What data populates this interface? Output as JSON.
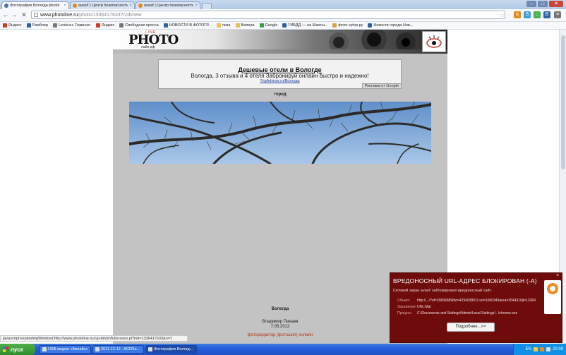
{
  "browser": {
    "tabs": [
      {
        "label": "Фотография Вологда photol",
        "active": true
      },
      {
        "label": "avast! | Центр безопасности",
        "active": false
      },
      {
        "label": "avast! | Центр безопасности",
        "active": false
      }
    ],
    "url_host": "www.photoline.ru",
    "url_path": "/photo/1336417633?rzdvnew",
    "window_buttons": {
      "min": "–",
      "max": "□",
      "close": "✕"
    }
  },
  "bookmarks": [
    {
      "label": "Яндекс",
      "icon": "yandex-icon"
    },
    {
      "label": "Рамблер",
      "icon": "rambler-icon"
    },
    {
      "label": "Lenta.ru: Главное:",
      "icon": "lenta-icon"
    },
    {
      "label": "Яндекс",
      "icon": "yandex-icon"
    },
    {
      "label": "Свободная пресса",
      "icon": "press-icon"
    },
    {
      "label": "НОВОСТИ В ФОТОГР...",
      "icon": "news-icon"
    },
    {
      "label": "лиза",
      "icon": "folder-icon"
    },
    {
      "label": "Валера",
      "icon": "folder-icon"
    },
    {
      "label": "Google",
      "icon": "google-icon"
    },
    {
      "label": "ГИБДД — на Шахты...",
      "icon": "gibdd-icon"
    },
    {
      "label": "фото.vуtор.ру",
      "icon": "photo-icon"
    },
    {
      "label": "Новости города Нов...",
      "icon": "city-news-icon"
    }
  ],
  "site": {
    "logo_text": "PHOTO",
    "logo_small": "LINE",
    "logo_sub": "лайн.рф"
  },
  "ad": {
    "title": "Дешевые отели в Вологде",
    "description": "Вологда, 3 отзыва и 4 отеля Забронируй онлайн быстро и надежно!",
    "url": "TripAdvisor.ru/Вологда",
    "by": "Реклама от Google"
  },
  "photo": {
    "title": "город",
    "caption": "Вологда",
    "author": "Владимир Пинаев",
    "date": "7.05.2012",
    "editor_link": "фоторедактор (фотошоп) онлайн"
  },
  "status_text": "javascript:expandingWindow('http://www.photoline.ru/cgi-bin/zr/fullscreen.pl?ind=1336417633&n=')",
  "avast": {
    "heading": "ВРЕДОНОСНЫЙ URL-АДРЕС БЛОКИРОВАН (-А)",
    "message": "Сетевой экран avast! заблокировал вредоносный сайт.",
    "rows": [
      {
        "key": "Объект:",
        "value": "http://.../?of=308348898id=429493801l cat=1000349area=3544310jt=13364"
      },
      {
        "key": "Заражение:",
        "value": "URL:Mal"
      },
      {
        "key": "Процесс:",
        "value": "C:\\Documents and Settings\\Admin\\Local Settings\\...\\chrome.exe"
      }
    ],
    "button": "Подробнее...>>"
  },
  "taskbar": {
    "start": "пуск",
    "items": [
      {
        "label": "USB-модем «Билайн»",
        "active": false
      },
      {
        "label": "2011-12-12 - ACDSe...",
        "active": false
      },
      {
        "label": "Фотография Вологд...",
        "active": true
      }
    ],
    "lang": "EN",
    "time": "20:09"
  }
}
